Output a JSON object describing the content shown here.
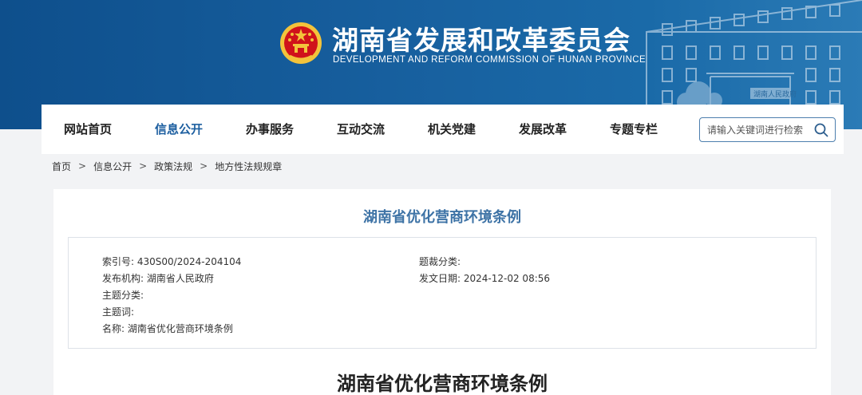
{
  "header": {
    "title_cn": "湖南省发展和改革委员会",
    "title_en": "DEVELOPMENT AND REFORM COMMISSION OF HUNAN PROVINCE",
    "building_sign": "湖南人民政府",
    "colors": {
      "banner": "#175f9e",
      "accent": "#1d5fa0",
      "emblem_red": "#d0121b",
      "emblem_gold": "#f3c33b"
    }
  },
  "nav": {
    "items": [
      {
        "label": "网站首页"
      },
      {
        "label": "信息公开",
        "active": true
      },
      {
        "label": "办事服务"
      },
      {
        "label": "互动交流"
      },
      {
        "label": "机关党建"
      },
      {
        "label": "发展改革"
      },
      {
        "label": "专题专栏"
      }
    ],
    "search": {
      "placeholder": "请输入关键词进行检索",
      "icon": "search-icon"
    }
  },
  "breadcrumb": {
    "items": [
      "首页",
      "信息公开",
      "政策法规",
      "地方性法规规章"
    ],
    "separator": ">"
  },
  "article": {
    "title": "湖南省优化营商环境条例",
    "meta": {
      "index_label": "索引号:",
      "index_value": "430S00/2024-204104",
      "category_label": "题裁分类:",
      "category_value": "",
      "publisher_label": "发布机构:",
      "publisher_value": "湖南省人民政府",
      "date_label": "发文日期:",
      "date_value": "2024-12-02 08:56",
      "topic_label": "主题分类:",
      "topic_value": "",
      "keywords_label": "主题词:",
      "keywords_value": "",
      "name_label": "名称:",
      "name_value": "湖南省优化营商环境条例"
    },
    "body_title": "湖南省优化营商环境条例"
  }
}
